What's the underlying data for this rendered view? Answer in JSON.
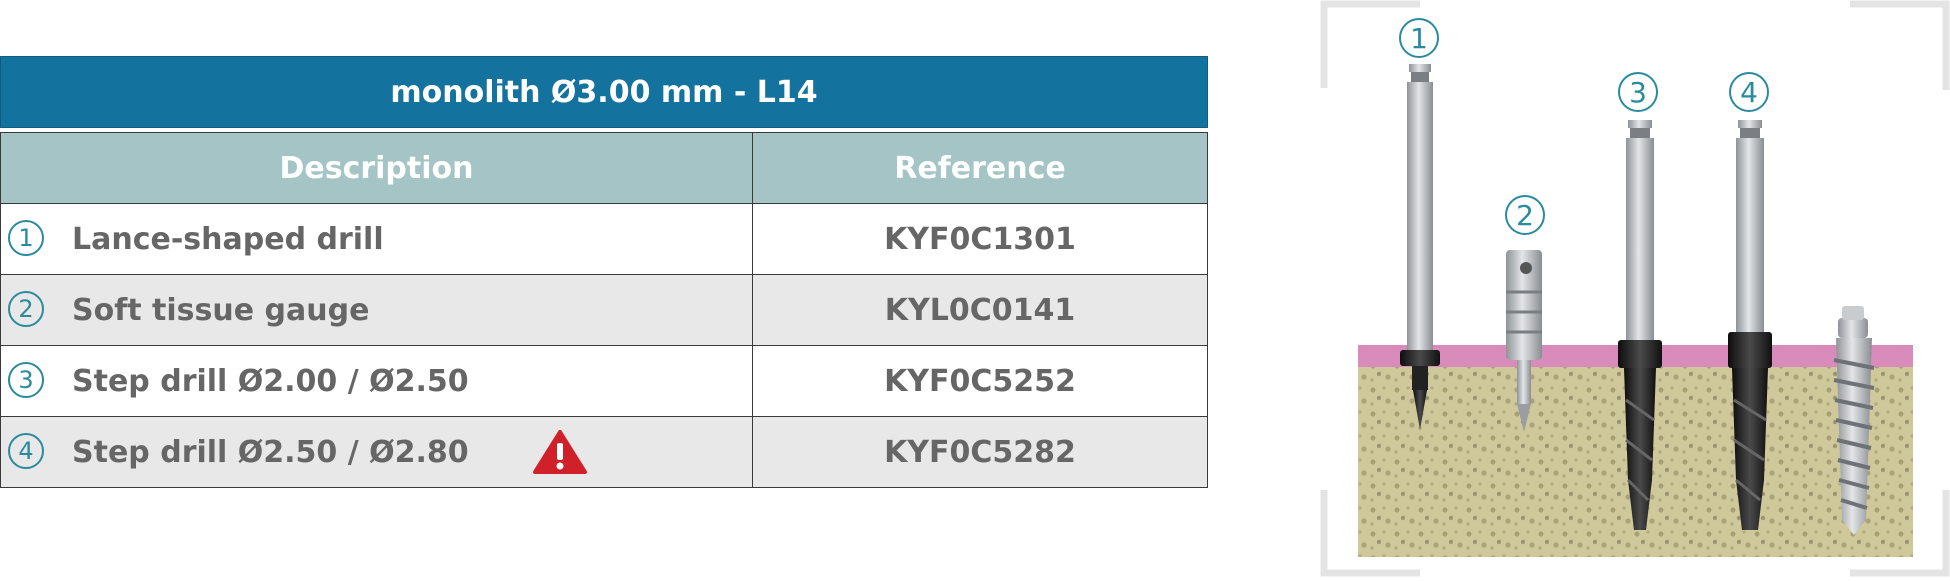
{
  "table": {
    "title": "monolith Ø3.00 mm - L14",
    "headers": {
      "description": "Description",
      "reference": "Reference"
    },
    "rows": [
      {
        "num": "1",
        "description": "Lance-shaped drill",
        "reference": "KYF0C1301",
        "warning": false
      },
      {
        "num": "2",
        "description": "Soft tissue gauge",
        "reference": "KYL0C0141",
        "warning": false
      },
      {
        "num": "3",
        "description": "Step drill Ø2.00 / Ø2.50",
        "reference": "KYF0C5252",
        "warning": true
      },
      {
        "num": "4",
        "description": "Step drill Ø2.50 / Ø2.80",
        "reference": "KYF0C5282",
        "warning": true
      }
    ]
  },
  "illustration": {
    "callouts": [
      "1",
      "2",
      "3",
      "4"
    ],
    "colors": {
      "gum": "#d98cbc",
      "bone": "#cfc89a",
      "steel": "#b9bcbf",
      "black": "#1c1c1c",
      "accent": "#2a8a9e",
      "header": "#14729f",
      "subheader": "#a4c4c6",
      "warning": "#d0202a"
    }
  }
}
